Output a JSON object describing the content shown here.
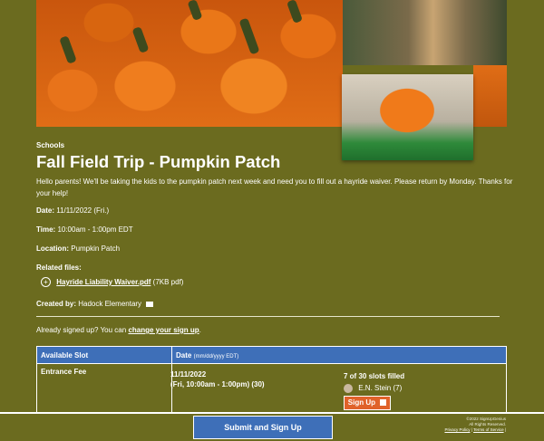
{
  "section": "Schools",
  "title": "Fall Field Trip - Pumpkin Patch",
  "intro": "Hello parents! We'll be taking the kids to the pumpkin patch next week and need you to fill out a hayride waiver. Please return by Monday. Thanks for your help!",
  "date": {
    "label": "Date:",
    "value": "11/11/2022 (Fri.)"
  },
  "time": {
    "label": "Time:",
    "value": "10:00am - 1:00pm EDT"
  },
  "location": {
    "label": "Location:",
    "value": "Pumpkin Patch"
  },
  "related_files": {
    "label": "Related files:",
    "file_name": "Hayride Liability Waiver.pdf",
    "file_meta": "(7KB pdf)"
  },
  "created_by": {
    "label": "Created by:",
    "value": "Hadock Elementary"
  },
  "already": {
    "text": "Already signed up? You can",
    "link": "change your sign up"
  },
  "table": {
    "col1": "Available Slot",
    "col2": "Date",
    "col2_format": "(mm/dd/yyyy EDT)",
    "row": {
      "slot": "Entrance Fee",
      "date": "11/11/2022",
      "time": "(Fri, 10:00am - 1:00pm) (30)",
      "filled": "7 of 30 slots filled",
      "person": "E.N. Stein (7)",
      "signup_label": "Sign Up"
    }
  },
  "submit_label": "Submit and Sign Up",
  "copyright": {
    "line1": "©2022 SignUpGenius",
    "line2": "All Rights Reserved.",
    "privacy": "Privacy Policy",
    "terms": "Terms of Service"
  }
}
